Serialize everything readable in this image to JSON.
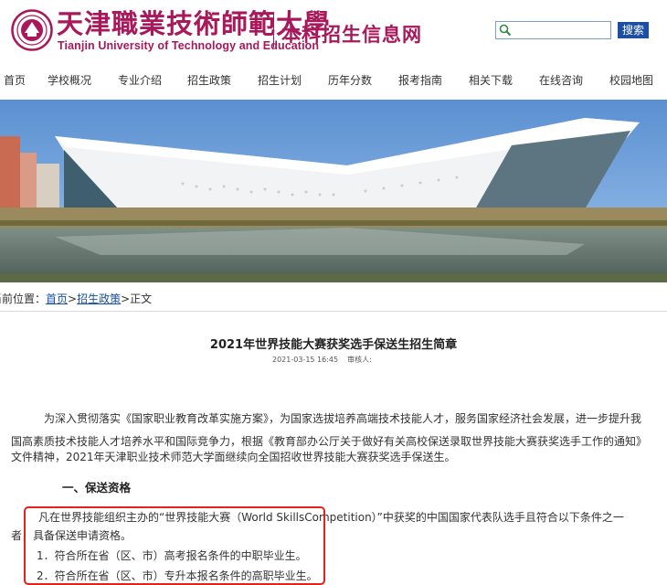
{
  "header": {
    "logo_cn": "天津職業技術師範大學",
    "logo_en": "Tianjin University of Technology and Education",
    "subtitle": "本科招生信息网",
    "search_value": "",
    "search_button": "搜索"
  },
  "nav": {
    "items": [
      "首页",
      "学校概况",
      "专业介绍",
      "招生政策",
      "招生计划",
      "历年分数",
      "报考指南",
      "相关下载",
      "在线咨询",
      "校园地图"
    ]
  },
  "breadcrumb": {
    "prefix": "当前位置：",
    "home": "首页",
    "sep1": ">",
    "section": "招生政策",
    "sep2": ">",
    "current": "正文"
  },
  "article": {
    "title": "2021年世界技能大赛获奖选手保送生招生简章",
    "date": "2021-03-15 16:45",
    "author": "审核人:",
    "intro_lines": [
      "为深入贯彻落实《国家职业教育改革实施方案》，为国家选拔培养高端技术技能人才，服务国家经济社会发展，进一步提升我",
      "国高素质技术技能人才培养水平和国际竞争力，根据《教育部办公厅关于做好有关高校保送录取世界技能大赛获奖选手工作的通知》",
      "文件精神，2021年天津职业技术师范大学面继续向全国招收世界技能大赛获奖选手保送生。"
    ],
    "section1_title": "一、保送资格",
    "qual_lines": [
      "凡在世界技能组织主办的“世界技能大赛（World SkillsCompetition）”中获奖的中国国家代表队选手且符合以下条件之一",
      "者，具备保送申请资格。",
      "1．符合所在省（区、市）高考报名条件的中职毕业生。",
      "2．符合所在省（区、市）专升本报名条件的高职毕业生。"
    ]
  },
  "colors": {
    "brand": "#a8185a",
    "link": "#1a4fa8",
    "search_button": "#1c4fa3",
    "highlight": "#e2231a"
  }
}
